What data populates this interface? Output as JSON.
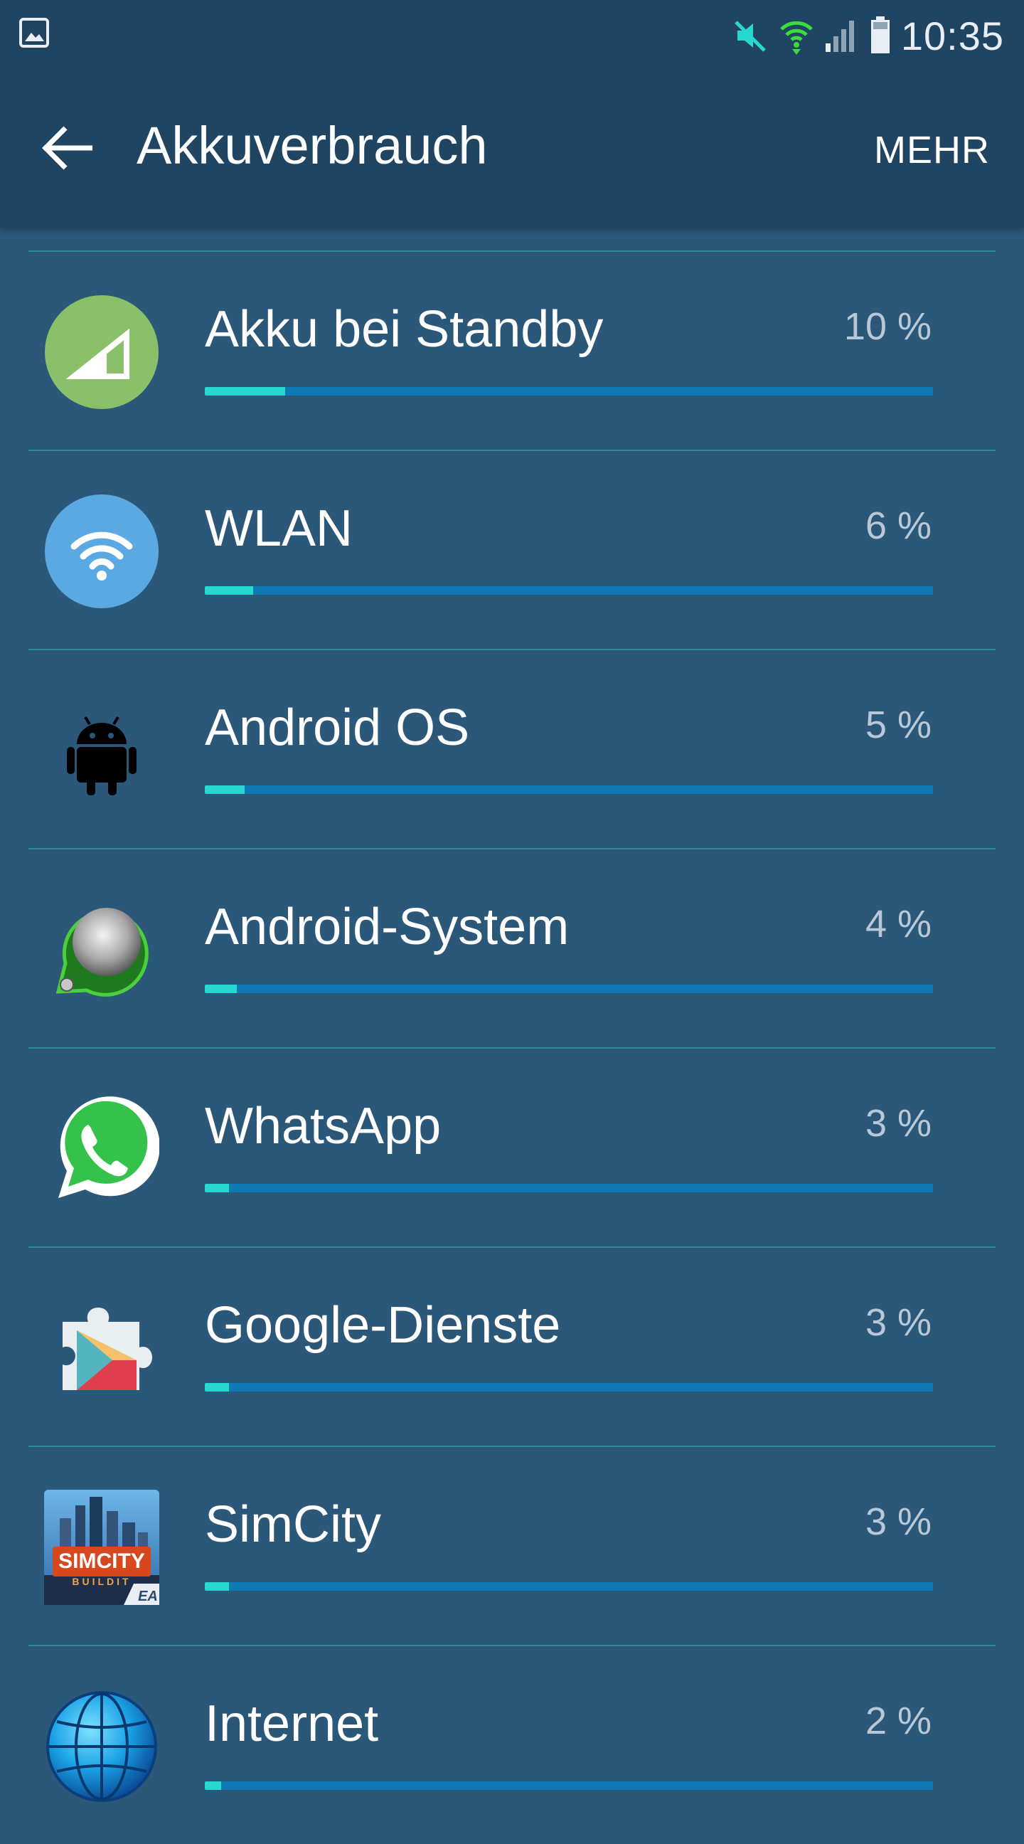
{
  "status": {
    "time": "10:35"
  },
  "appbar": {
    "title": "Akkuverbrauch",
    "more_label": "MEHR"
  },
  "colors": {
    "accent": "#27d7d0",
    "bar_track": "#0e79b2",
    "background": "#2b5779",
    "header": "#204563"
  },
  "items": [
    {
      "label": "Akku bei Standby",
      "percent": "10 %",
      "fraction": 0.1,
      "icon": "signal-icon"
    },
    {
      "label": "WLAN",
      "percent": "6 %",
      "fraction": 0.06,
      "icon": "wifi-icon"
    },
    {
      "label": "Android OS",
      "percent": "5 %",
      "fraction": 0.05,
      "icon": "android-icon"
    },
    {
      "label": "Android-System",
      "percent": "4 %",
      "fraction": 0.04,
      "icon": "android-system-icon"
    },
    {
      "label": "WhatsApp",
      "percent": "3 %",
      "fraction": 0.03,
      "icon": "whatsapp-icon"
    },
    {
      "label": "Google-Dienste",
      "percent": "3 %",
      "fraction": 0.03,
      "icon": "google-play-services-icon"
    },
    {
      "label": "SimCity",
      "percent": "3 %",
      "fraction": 0.03,
      "icon": "simcity-icon"
    },
    {
      "label": "Internet",
      "percent": "2 %",
      "fraction": 0.02,
      "icon": "internet-globe-icon"
    }
  ],
  "simcity_logo_text": {
    "line1": "SIMCITY",
    "line2": "BUILDIT",
    "brand": "EA"
  }
}
